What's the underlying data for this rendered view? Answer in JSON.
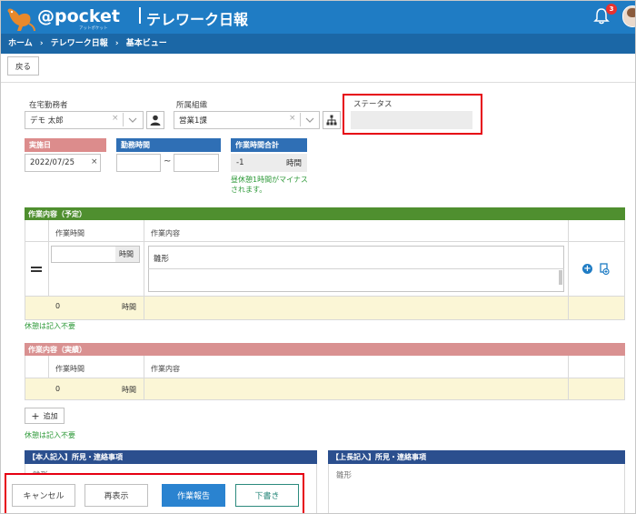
{
  "header": {
    "logo_text": "@pocket",
    "logo_sub": "アットポケット",
    "app_title": "テレワーク日報",
    "notification_count": "3"
  },
  "breadcrumb": {
    "items": [
      "ホーム",
      "テレワーク日報",
      "基本ビュー"
    ],
    "separator": "›"
  },
  "toolbar": {
    "back_label": "戻る"
  },
  "form": {
    "worker_label": "在宅勤務者",
    "worker_value": "デモ 太郎",
    "org_label": "所属組織",
    "org_value": "営業1課",
    "status_label": "ステータス",
    "status_value": "",
    "date_tag": "実施日",
    "date_value": "2022/07/25",
    "worktime_tag": "勤務時間",
    "worktime_sep": "~",
    "total_tag": "作業時間合計",
    "total_value": "-1",
    "total_unit": "時間",
    "total_note": "昼休憩1時間がマイナスされます。"
  },
  "plan": {
    "title": "作業内容（予定）",
    "col_time": "作業時間",
    "col_content": "作業内容",
    "time_unit": "時間",
    "content_value": "雛形",
    "sum_value": "0",
    "sum_unit": "時間",
    "note": "休憩は記入不要"
  },
  "actual": {
    "title": "作業内容（実績）",
    "col_time": "作業時間",
    "col_content": "作業内容",
    "sum_value": "0",
    "sum_unit": "時間",
    "add_label": "追加",
    "note": "休憩は記入不要"
  },
  "comments": {
    "self_title": "【本人記入】所見・連絡事項",
    "boss_title": "【上長記入】所見・連絡事項",
    "self_value": "雛形",
    "boss_value": "雛形"
  },
  "footer": {
    "cancel_label": "キャンセル",
    "reload_label": "再表示",
    "report_label": "作業報告",
    "draft_label": "下書き"
  },
  "colors": {
    "header_blue": "#1f7cc4",
    "tag_red": "#dc8c8c",
    "tag_blue": "#2f6fb5",
    "plan_green": "#4f8f2f",
    "actual_red": "#d99191",
    "self_navy": "#2b4f8e",
    "report_btn": "#2a83d0",
    "draft_teal": "#2c8a7d",
    "highlight": "#e60012",
    "sum_row": "#fbf6d6"
  }
}
